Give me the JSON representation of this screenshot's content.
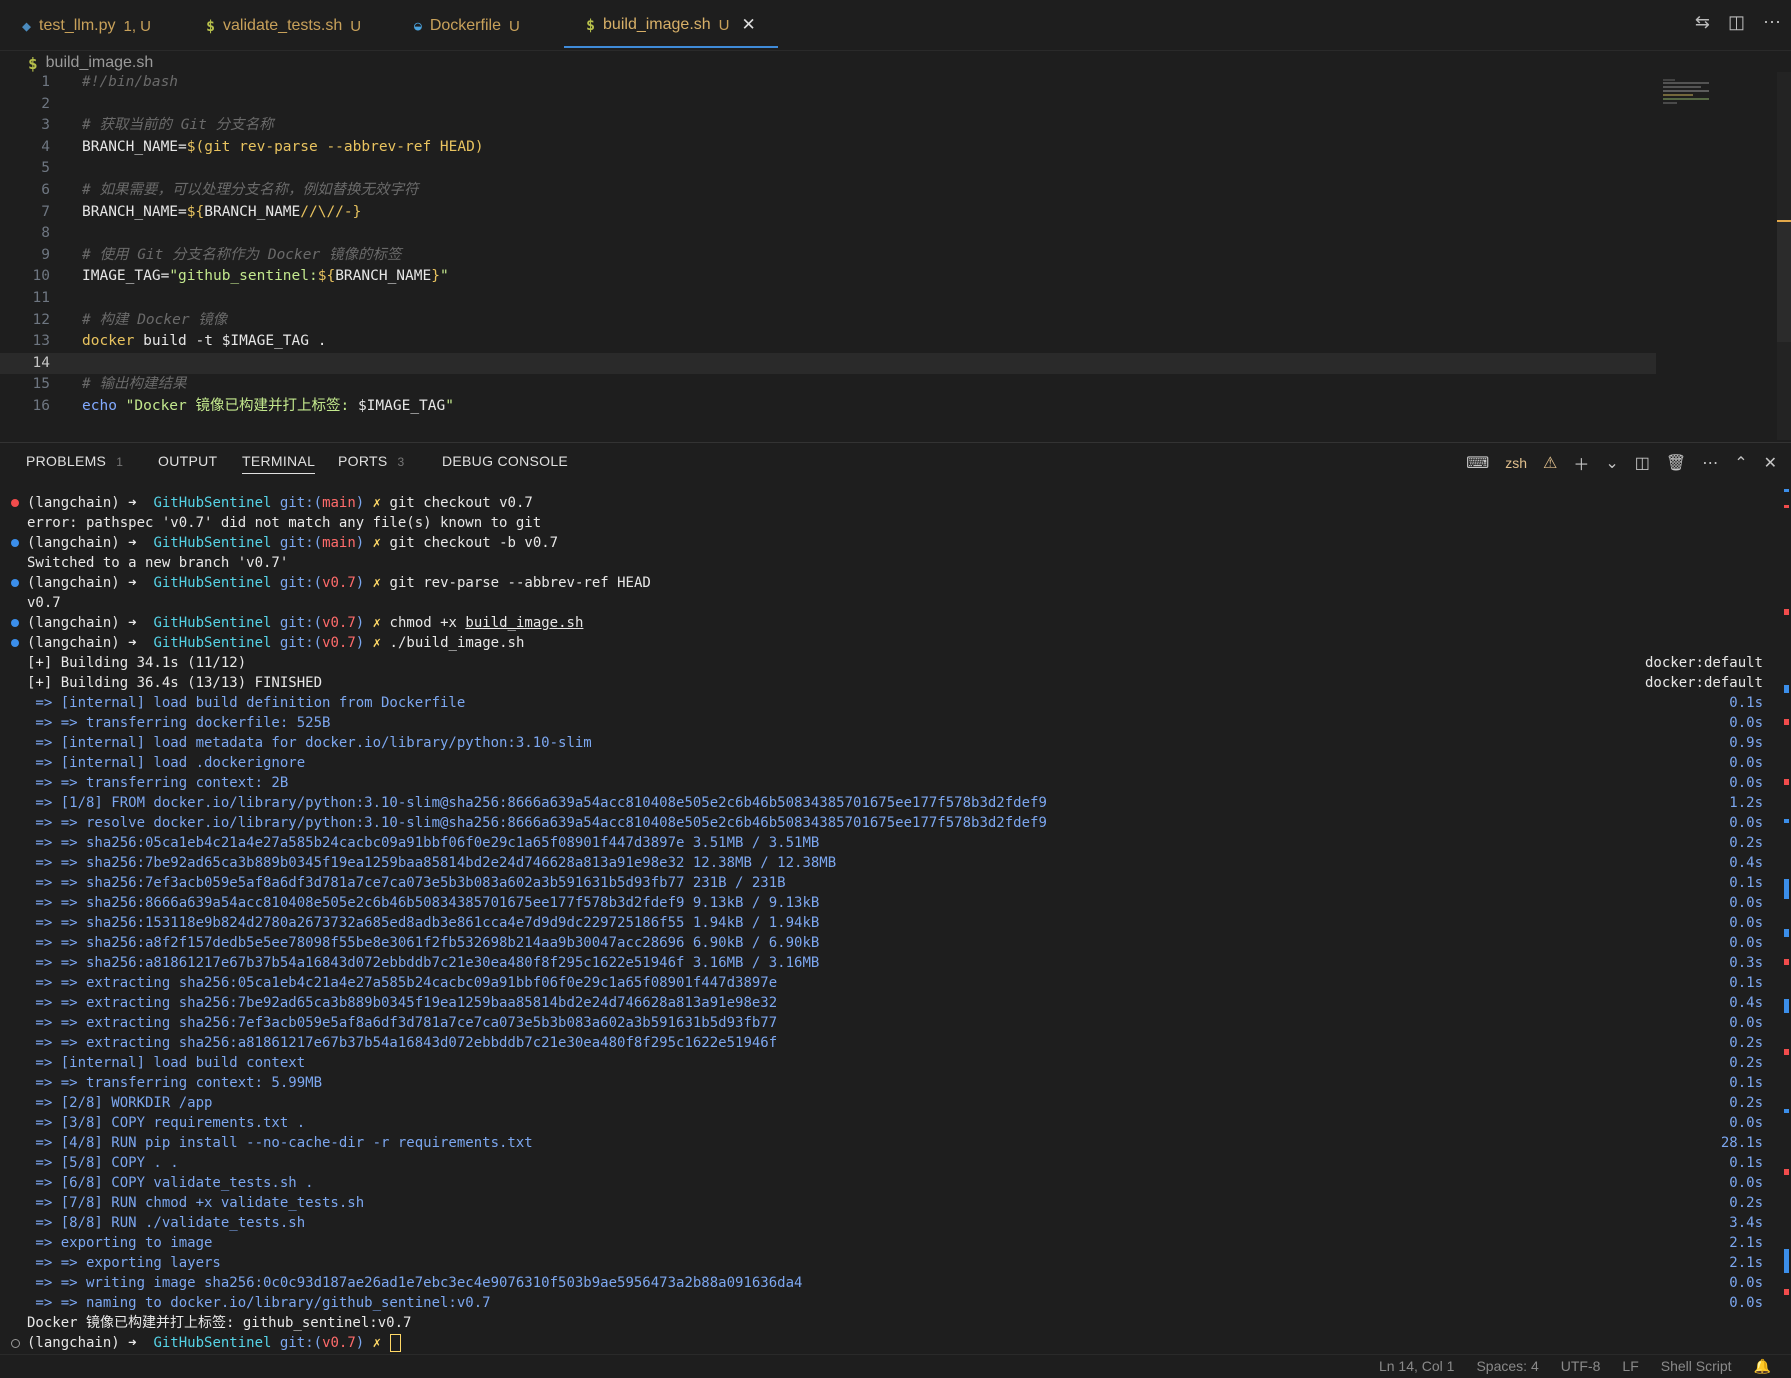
{
  "tabs": [
    {
      "icon": "python-icon",
      "glyph": "◆",
      "label": "test_llm.py",
      "status": "1, U",
      "left": 0
    },
    {
      "icon": "shell-icon",
      "glyph": "$",
      "label": "validate_tests.sh",
      "status": "U"
    },
    {
      "icon": "docker-icon",
      "glyph": "🐳",
      "label": "Dockerfile",
      "status": "U"
    },
    {
      "icon": "shell-icon",
      "glyph": "$",
      "label": "build_image.sh",
      "status": "U",
      "active": true
    }
  ],
  "breadcrumb": {
    "glyph": "$",
    "file": "build_image.sh"
  },
  "editor": {
    "lines": [
      "1",
      "2",
      "3",
      "4",
      "5",
      "6",
      "7",
      "8",
      "9",
      "10",
      "11",
      "12",
      "13",
      "14",
      "15",
      "16"
    ],
    "current_line": 14
  },
  "panel": {
    "tabs": [
      {
        "label": "PROBLEMS",
        "badge": "1"
      },
      {
        "label": "OUTPUT"
      },
      {
        "label": "TERMINAL",
        "active": true
      },
      {
        "label": "PORTS",
        "badge": "3"
      },
      {
        "label": "DEBUG CONSOLE"
      }
    ],
    "shell": "zsh"
  },
  "terminal": {
    "prompt_env": "(langchain)",
    "prompt_arrow": "➜",
    "prompt_dir": "GitHubSentinel",
    "prompt_git": "git:(",
    "prompt_close": ")",
    "prompt_x": "✗",
    "cmd1_branch": "main",
    "cmd1": "git checkout v0.7",
    "err1": "error: pathspec 'v0.7' did not match any file(s) known to git",
    "cmd2_branch": "main",
    "cmd2": "git checkout -b v0.7",
    "out2": "Switched to a new branch 'v0.7'",
    "cmd3_branch": "v0.7",
    "cmd3": "git rev-parse --abbrev-ref HEAD",
    "out3": "v0.7",
    "cmd4_branch": "v0.7",
    "cmd4_pre": "chmod +x ",
    "cmd4_file": "build_image.sh",
    "cmd5_branch": "v0.7",
    "cmd5": "./build_image.sh",
    "building1": "[+] Building 34.1s (11/12)",
    "building1_ctx": "docker:default",
    "building2": "[+] Building 36.4s (13/13) FINISHED",
    "building2_ctx": "docker:default",
    "steps": [
      {
        "t": " => [internal] load build definition from Dockerfile",
        "d": "0.1s"
      },
      {
        "t": " => => transferring dockerfile: 525B",
        "d": "0.0s"
      },
      {
        "t": " => [internal] load metadata for docker.io/library/python:3.10-slim",
        "d": "0.9s"
      },
      {
        "t": " => [internal] load .dockerignore",
        "d": "0.0s"
      },
      {
        "t": " => => transferring context: 2B",
        "d": "0.0s"
      },
      {
        "t": " => [1/8] FROM docker.io/library/python:3.10-slim@sha256:8666a639a54acc810408e505e2c6b46b50834385701675ee177f578b3d2fdef9",
        "d": "1.2s"
      },
      {
        "t": " => => resolve docker.io/library/python:3.10-slim@sha256:8666a639a54acc810408e505e2c6b46b50834385701675ee177f578b3d2fdef9",
        "d": "0.0s"
      },
      {
        "t": " => => sha256:05ca1eb4c21a4e27a585b24cacbc09a91bbf06f0e29c1a65f08901f447d3897e 3.51MB / 3.51MB",
        "d": "0.2s"
      },
      {
        "t": " => => sha256:7be92ad65ca3b889b0345f19ea1259baa85814bd2e24d746628a813a91e98e32 12.38MB / 12.38MB",
        "d": "0.4s"
      },
      {
        "t": " => => sha256:7ef3acb059e5af8a6df3d781a7ce7ca073e5b3b083a602a3b591631b5d93fb77 231B / 231B",
        "d": "0.1s"
      },
      {
        "t": " => => sha256:8666a639a54acc810408e505e2c6b46b50834385701675ee177f578b3d2fdef9 9.13kB / 9.13kB",
        "d": "0.0s"
      },
      {
        "t": " => => sha256:153118e9b824d2780a2673732a685ed8adb3e861cca4e7d9d9dc229725186f55 1.94kB / 1.94kB",
        "d": "0.0s"
      },
      {
        "t": " => => sha256:a8f2f157dedb5e5ee78098f55be8e3061f2fb532698b214aa9b30047acc28696 6.90kB / 6.90kB",
        "d": "0.0s"
      },
      {
        "t": " => => sha256:a81861217e67b37b54a16843d072ebbddb7c21e30ea480f8f295c1622e51946f 3.16MB / 3.16MB",
        "d": "0.3s"
      },
      {
        "t": " => => extracting sha256:05ca1eb4c21a4e27a585b24cacbc09a91bbf06f0e29c1a65f08901f447d3897e",
        "d": "0.1s"
      },
      {
        "t": " => => extracting sha256:7be92ad65ca3b889b0345f19ea1259baa85814bd2e24d746628a813a91e98e32",
        "d": "0.4s"
      },
      {
        "t": " => => extracting sha256:7ef3acb059e5af8a6df3d781a7ce7ca073e5b3b083a602a3b591631b5d93fb77",
        "d": "0.0s"
      },
      {
        "t": " => => extracting sha256:a81861217e67b37b54a16843d072ebbddb7c21e30ea480f8f295c1622e51946f",
        "d": "0.2s"
      },
      {
        "t": " => [internal] load build context",
        "d": "0.2s"
      },
      {
        "t": " => => transferring context: 5.99MB",
        "d": "0.1s"
      },
      {
        "t": " => [2/8] WORKDIR /app",
        "d": "0.2s"
      },
      {
        "t": " => [3/8] COPY requirements.txt .",
        "d": "0.0s"
      },
      {
        "t": " => [4/8] RUN pip install --no-cache-dir -r requirements.txt",
        "d": "28.1s"
      },
      {
        "t": " => [5/8] COPY . .",
        "d": "0.1s"
      },
      {
        "t": " => [6/8] COPY validate_tests.sh .",
        "d": "0.0s"
      },
      {
        "t": " => [7/8] RUN chmod +x validate_tests.sh",
        "d": "0.2s"
      },
      {
        "t": " => [8/8] RUN ./validate_tests.sh",
        "d": "3.4s"
      },
      {
        "t": " => exporting to image",
        "d": "2.1s"
      },
      {
        "t": " => => exporting layers",
        "d": "2.1s"
      },
      {
        "t": " => => writing image sha256:0c0c93d187ae26ad1e7ebc3ec4e9076310f503b9ae5956473a2b88a091636da4",
        "d": "0.0s"
      },
      {
        "t": " => => naming to docker.io/library/github_sentinel:v0.7",
        "d": "0.0s"
      }
    ],
    "final": "Docker 镜像已构建并打上标签: github_sentinel:v0.7",
    "last_branch": "v0.7"
  },
  "statusbar": {
    "position": "Ln 14, Col 1",
    "spaces": "Spaces: 4",
    "encoding": "UTF-8",
    "eol": "LF",
    "language": "Shell Script"
  }
}
